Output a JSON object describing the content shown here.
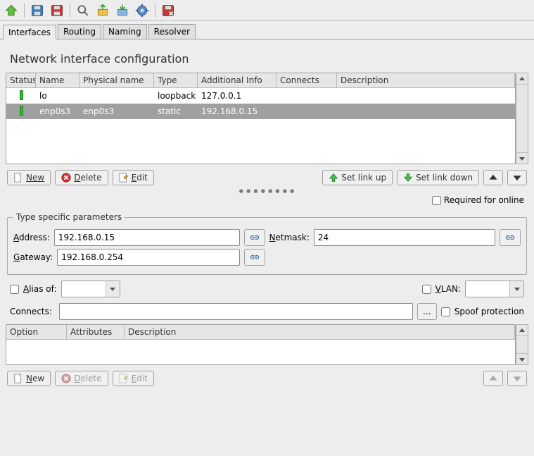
{
  "toolbar_icons": [
    "back",
    "save",
    "save-as",
    "search",
    "import",
    "export",
    "settings",
    "quit"
  ],
  "tabs": [
    {
      "label": "Interfaces",
      "active": true
    },
    {
      "label": "Routing",
      "active": false
    },
    {
      "label": "Naming",
      "active": false
    },
    {
      "label": "Resolver",
      "active": false
    }
  ],
  "page_title": "Network interface configuration",
  "iface_table": {
    "headers": {
      "status": "Status",
      "name": "Name",
      "pname": "Physical name",
      "type": "Type",
      "ainfo": "Additional Info",
      "conn": "Connects",
      "desc": "Description"
    },
    "rows": [
      {
        "status": "up",
        "name": "lo",
        "pname": "",
        "type": "loopback",
        "ainfo": "127.0.0.1",
        "conn": "",
        "desc": "",
        "selected": false
      },
      {
        "status": "up",
        "name": "enp0s3",
        "pname": "enp0s3",
        "type": "static",
        "ainfo": "192.168.0.15",
        "conn": "",
        "desc": "",
        "selected": true
      }
    ]
  },
  "buttons": {
    "new": "New",
    "delete": "Delete",
    "edit": "Edit",
    "linkup": "Set link up",
    "linkdown": "Set link down"
  },
  "required_for_online": "Required for online",
  "type_params_legend": "Type specific parameters",
  "fields": {
    "address_label": "Address:",
    "address": "192.168.0.15",
    "netmask_label": "Netmask:",
    "netmask": "24",
    "gateway_label": "Gateway:",
    "gateway": "192.168.0.254",
    "aliasof_label": "Alias of:",
    "aliasof": "",
    "vlan_label": "VLAN:",
    "vlan": "",
    "connects_label": "Connects:",
    "connects": "",
    "spoof_label": "Spoof protection"
  },
  "opt_table": {
    "headers": {
      "option": "Option",
      "attrs": "Attributes",
      "desc": "Description"
    },
    "rows": []
  }
}
